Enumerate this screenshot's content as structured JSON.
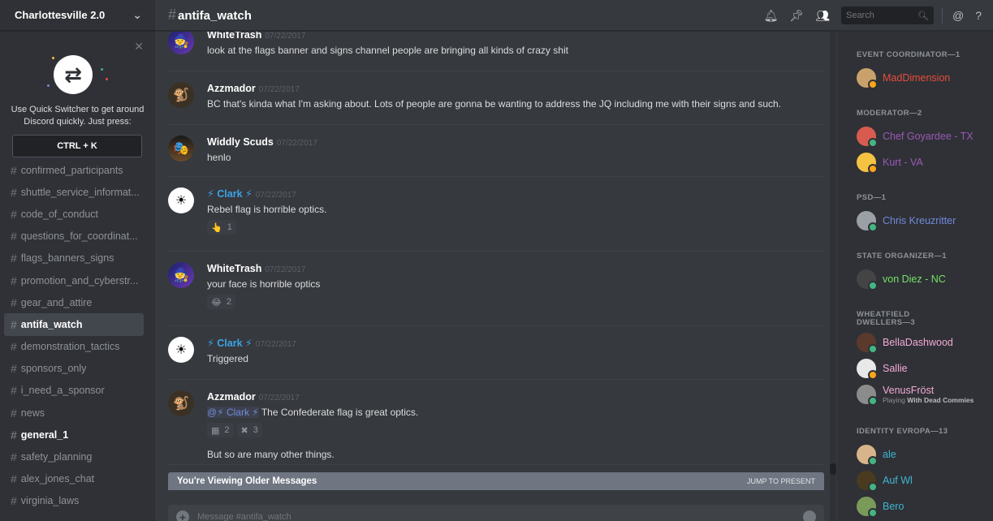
{
  "server": {
    "name": "Charlottesville 2.0"
  },
  "quick_switcher": {
    "text": "Use Quick Switcher to get around Discord quickly. Just press:",
    "shortcut": "CTRL + K"
  },
  "channels": [
    {
      "name": "confirmed_participants",
      "state": "normal"
    },
    {
      "name": "shuttle_service_informat...",
      "state": "normal"
    },
    {
      "name": "code_of_conduct",
      "state": "normal"
    },
    {
      "name": "questions_for_coordinat...",
      "state": "normal"
    },
    {
      "name": "flags_banners_signs",
      "state": "normal"
    },
    {
      "name": "promotion_and_cyberstr...",
      "state": "normal"
    },
    {
      "name": "gear_and_attire",
      "state": "normal"
    },
    {
      "name": "antifa_watch",
      "state": "active"
    },
    {
      "name": "demonstration_tactics",
      "state": "normal"
    },
    {
      "name": "sponsors_only",
      "state": "normal"
    },
    {
      "name": "i_need_a_sponsor",
      "state": "normal"
    },
    {
      "name": "news",
      "state": "normal"
    },
    {
      "name": "general_1",
      "state": "unread"
    },
    {
      "name": "safety_planning",
      "state": "normal"
    },
    {
      "name": "alex_jones_chat",
      "state": "normal"
    },
    {
      "name": "virginia_laws",
      "state": "normal"
    }
  ],
  "header": {
    "channel": "antifa_watch",
    "search_placeholder": "Search"
  },
  "messages": [
    {
      "author": "WhiteTrash",
      "timestamp": "07/22/2017",
      "text": "look at the flags banner and signs channel people are bringing all kinds of crazy shit"
    },
    {
      "author": "Azzmador",
      "timestamp": "07/22/2017",
      "text": "BC that's kinda what I'm asking about. Lots of people are gonna be wanting to address the JQ including me with their signs and such."
    },
    {
      "author": "Widdly Scuds",
      "timestamp": "07/22/2017",
      "text": "henlo"
    },
    {
      "author": "⚡ Clark ⚡",
      "timestamp": "07/22/2017",
      "text": "Rebel flag is horrible optics.",
      "reactions": [
        {
          "emoji": "👆",
          "count": "1"
        }
      ]
    },
    {
      "author": "WhiteTrash",
      "timestamp": "07/22/2017",
      "text": "your face is horrible optics",
      "reactions": [
        {
          "emoji": "😂",
          "count": "2"
        }
      ]
    },
    {
      "author": "⚡ Clark ⚡",
      "timestamp": "07/22/2017",
      "text": "Triggered"
    },
    {
      "author": "Azzmador",
      "timestamp": "07/22/2017",
      "mention": "@⚡ Clark ⚡",
      "text": "The Confederate flag is great optics.",
      "reactions": [
        {
          "emoji": "▦",
          "count": "2"
        },
        {
          "emoji": "✖",
          "count": "3"
        }
      ],
      "text2": "But so are many other things."
    }
  ],
  "older_bar": {
    "label": "You're Viewing Older Messages",
    "action": "JUMP TO PRESENT"
  },
  "composer": {
    "placeholder": "Message #antifa_watch"
  },
  "member_groups": [
    {
      "role": "EVENT COORDINATOR—1",
      "members": [
        {
          "name": "MadDimension",
          "color": "#e74c3c",
          "status": "#faa61a"
        }
      ]
    },
    {
      "role": "MODERATOR—2",
      "members": [
        {
          "name": "Chef Goyardee - TX",
          "color": "#9b59b6",
          "status": "#43b581"
        },
        {
          "name": "Kurt - VA",
          "color": "#9b59b6",
          "status": "#faa61a"
        }
      ]
    },
    {
      "role": "PSD—1",
      "members": [
        {
          "name": "Chris Kreuzritter",
          "color": "#7289da",
          "status": "#43b581"
        }
      ]
    },
    {
      "role": "STATE ORGANIZER—1",
      "members": [
        {
          "name": "von Diez - NC",
          "color": "#77e065",
          "status": "#43b581"
        }
      ]
    },
    {
      "role": "WHEATFIELD DWELLERS—3",
      "members": [
        {
          "name": "BellaDashwood",
          "color": "#f5a9d6",
          "status": "#43b581"
        },
        {
          "name": "Sallie",
          "color": "#f5a9d6",
          "status": "#faa61a"
        },
        {
          "name": "VenusFröst",
          "color": "#f5a9d6",
          "status": "#43b581",
          "activity_prefix": "Playing",
          "activity": "With Dead Commies"
        }
      ]
    },
    {
      "role": "IDENTITY EVROPA—13",
      "members": [
        {
          "name": "ale",
          "color": "#3fb6d1",
          "status": "#43b581"
        },
        {
          "name": "Auf Wl",
          "color": "#3fb6d1",
          "status": "#43b581"
        },
        {
          "name": "Bero",
          "color": "#3fb6d1",
          "status": "#43b581"
        }
      ]
    }
  ]
}
